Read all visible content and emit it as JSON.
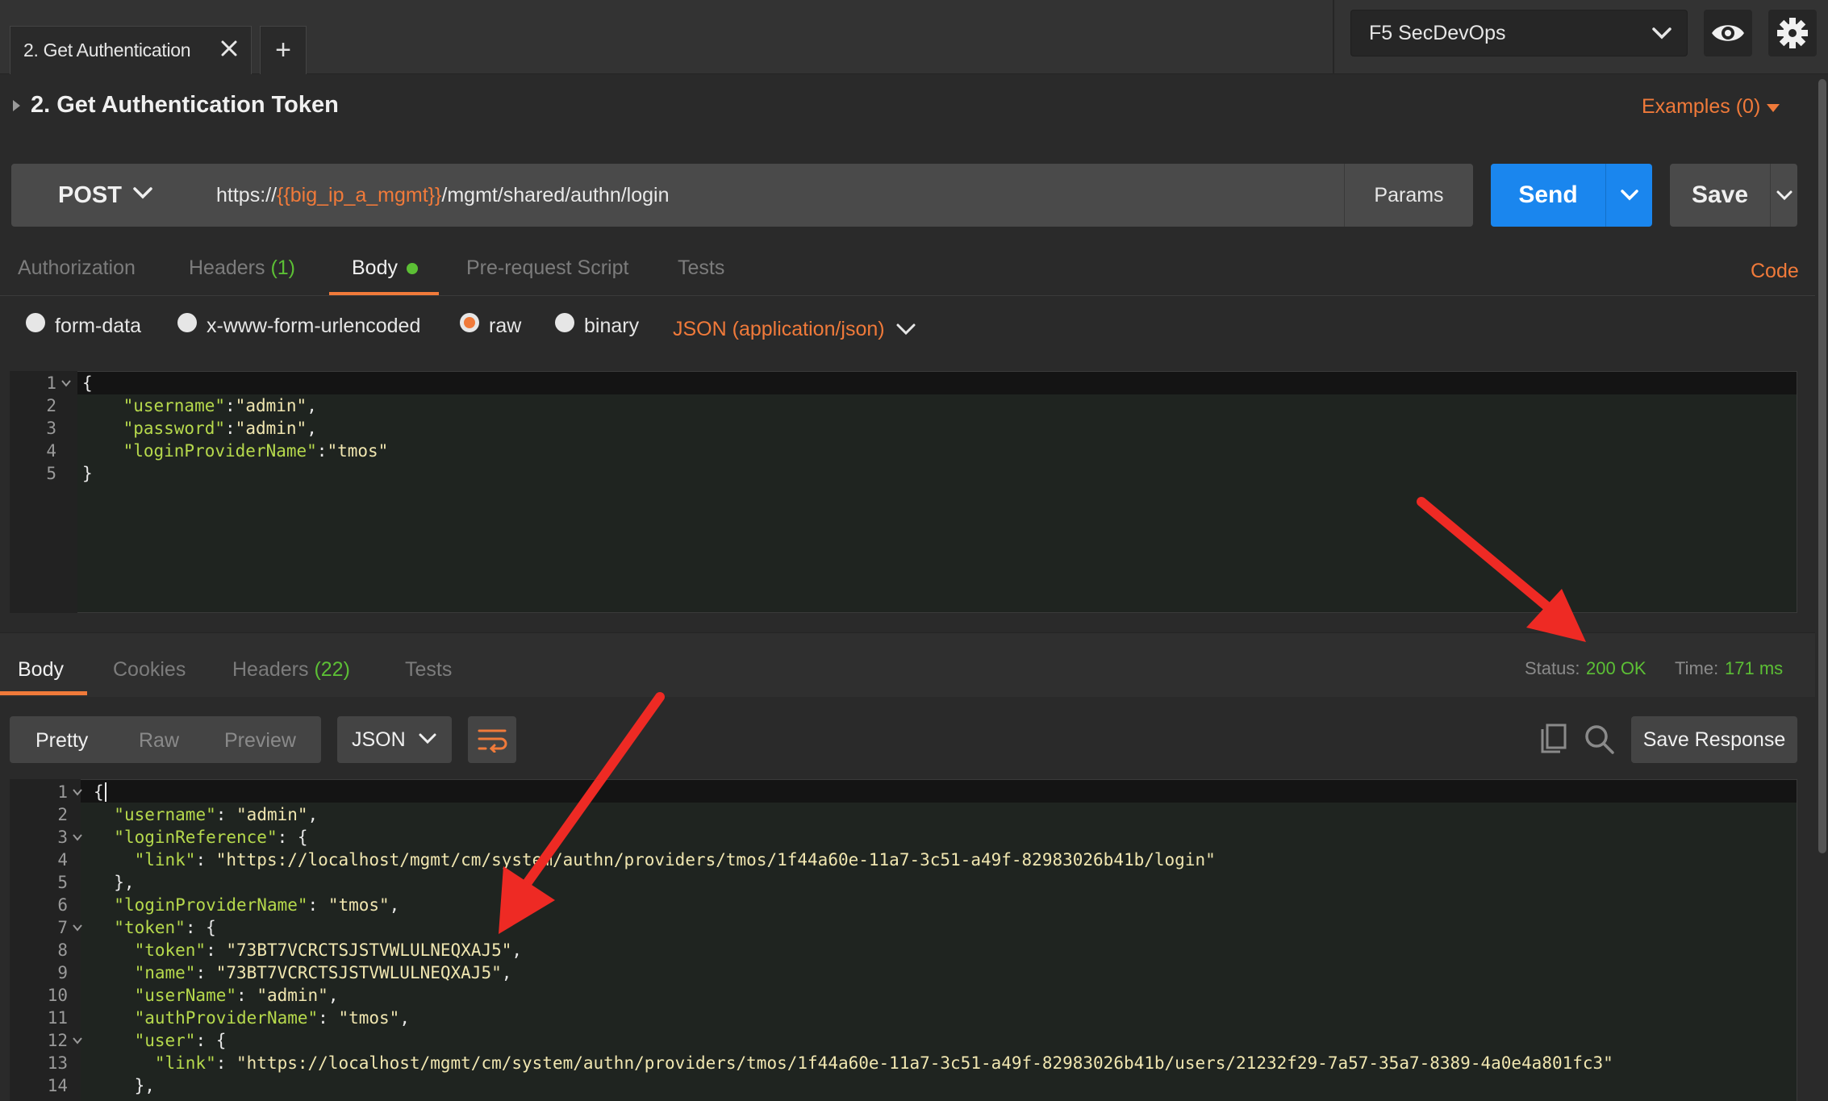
{
  "tab": {
    "label": "2. Get Authentication",
    "add_label": "+"
  },
  "environment": {
    "selected": "F5 SecDevOps"
  },
  "request": {
    "title": "2. Get Authentication Token",
    "examples": "Examples (0)",
    "method": "POST",
    "url": {
      "prefix": "https://",
      "variable": "{{big_ip_a_mgmt}}",
      "suffix": "/mgmt/shared/authn/login"
    },
    "params_label": "Params",
    "send_label": "Send",
    "save_label": "Save",
    "code_link": "Code",
    "tabs": [
      {
        "label": "Authorization"
      },
      {
        "label": "Headers",
        "count": "(1)"
      },
      {
        "label": "Body"
      },
      {
        "label": "Pre-request Script"
      },
      {
        "label": "Tests"
      }
    ],
    "body_types": [
      "form-data",
      "x-www-form-urlencoded",
      "raw",
      "binary"
    ],
    "body_type_selected": "raw",
    "content_type": "JSON (application/json)",
    "body_lines": [
      "1",
      "2",
      "3",
      "4",
      "5"
    ]
  },
  "response": {
    "tabs": [
      {
        "label": "Body"
      },
      {
        "label": "Cookies"
      },
      {
        "label": "Headers",
        "count": "(22)"
      },
      {
        "label": "Tests"
      }
    ],
    "status_label": "Status:",
    "status_value": "200 OK",
    "time_label": "Time:",
    "time_value": "171 ms",
    "view_modes": [
      "Pretty",
      "Raw",
      "Preview"
    ],
    "format": "JSON",
    "save_response_label": "Save Response",
    "line_numbers": [
      "1",
      "2",
      "3",
      "4",
      "5",
      "6",
      "7",
      "8",
      "9",
      "10",
      "11",
      "12",
      "13",
      "14"
    ]
  },
  "colors": {
    "accent": "#f07a3a",
    "send": "#1a86ee",
    "ok": "#5cbf35",
    "json_key": "#b6d94c",
    "annotation_arrow": "#ee2a24"
  }
}
